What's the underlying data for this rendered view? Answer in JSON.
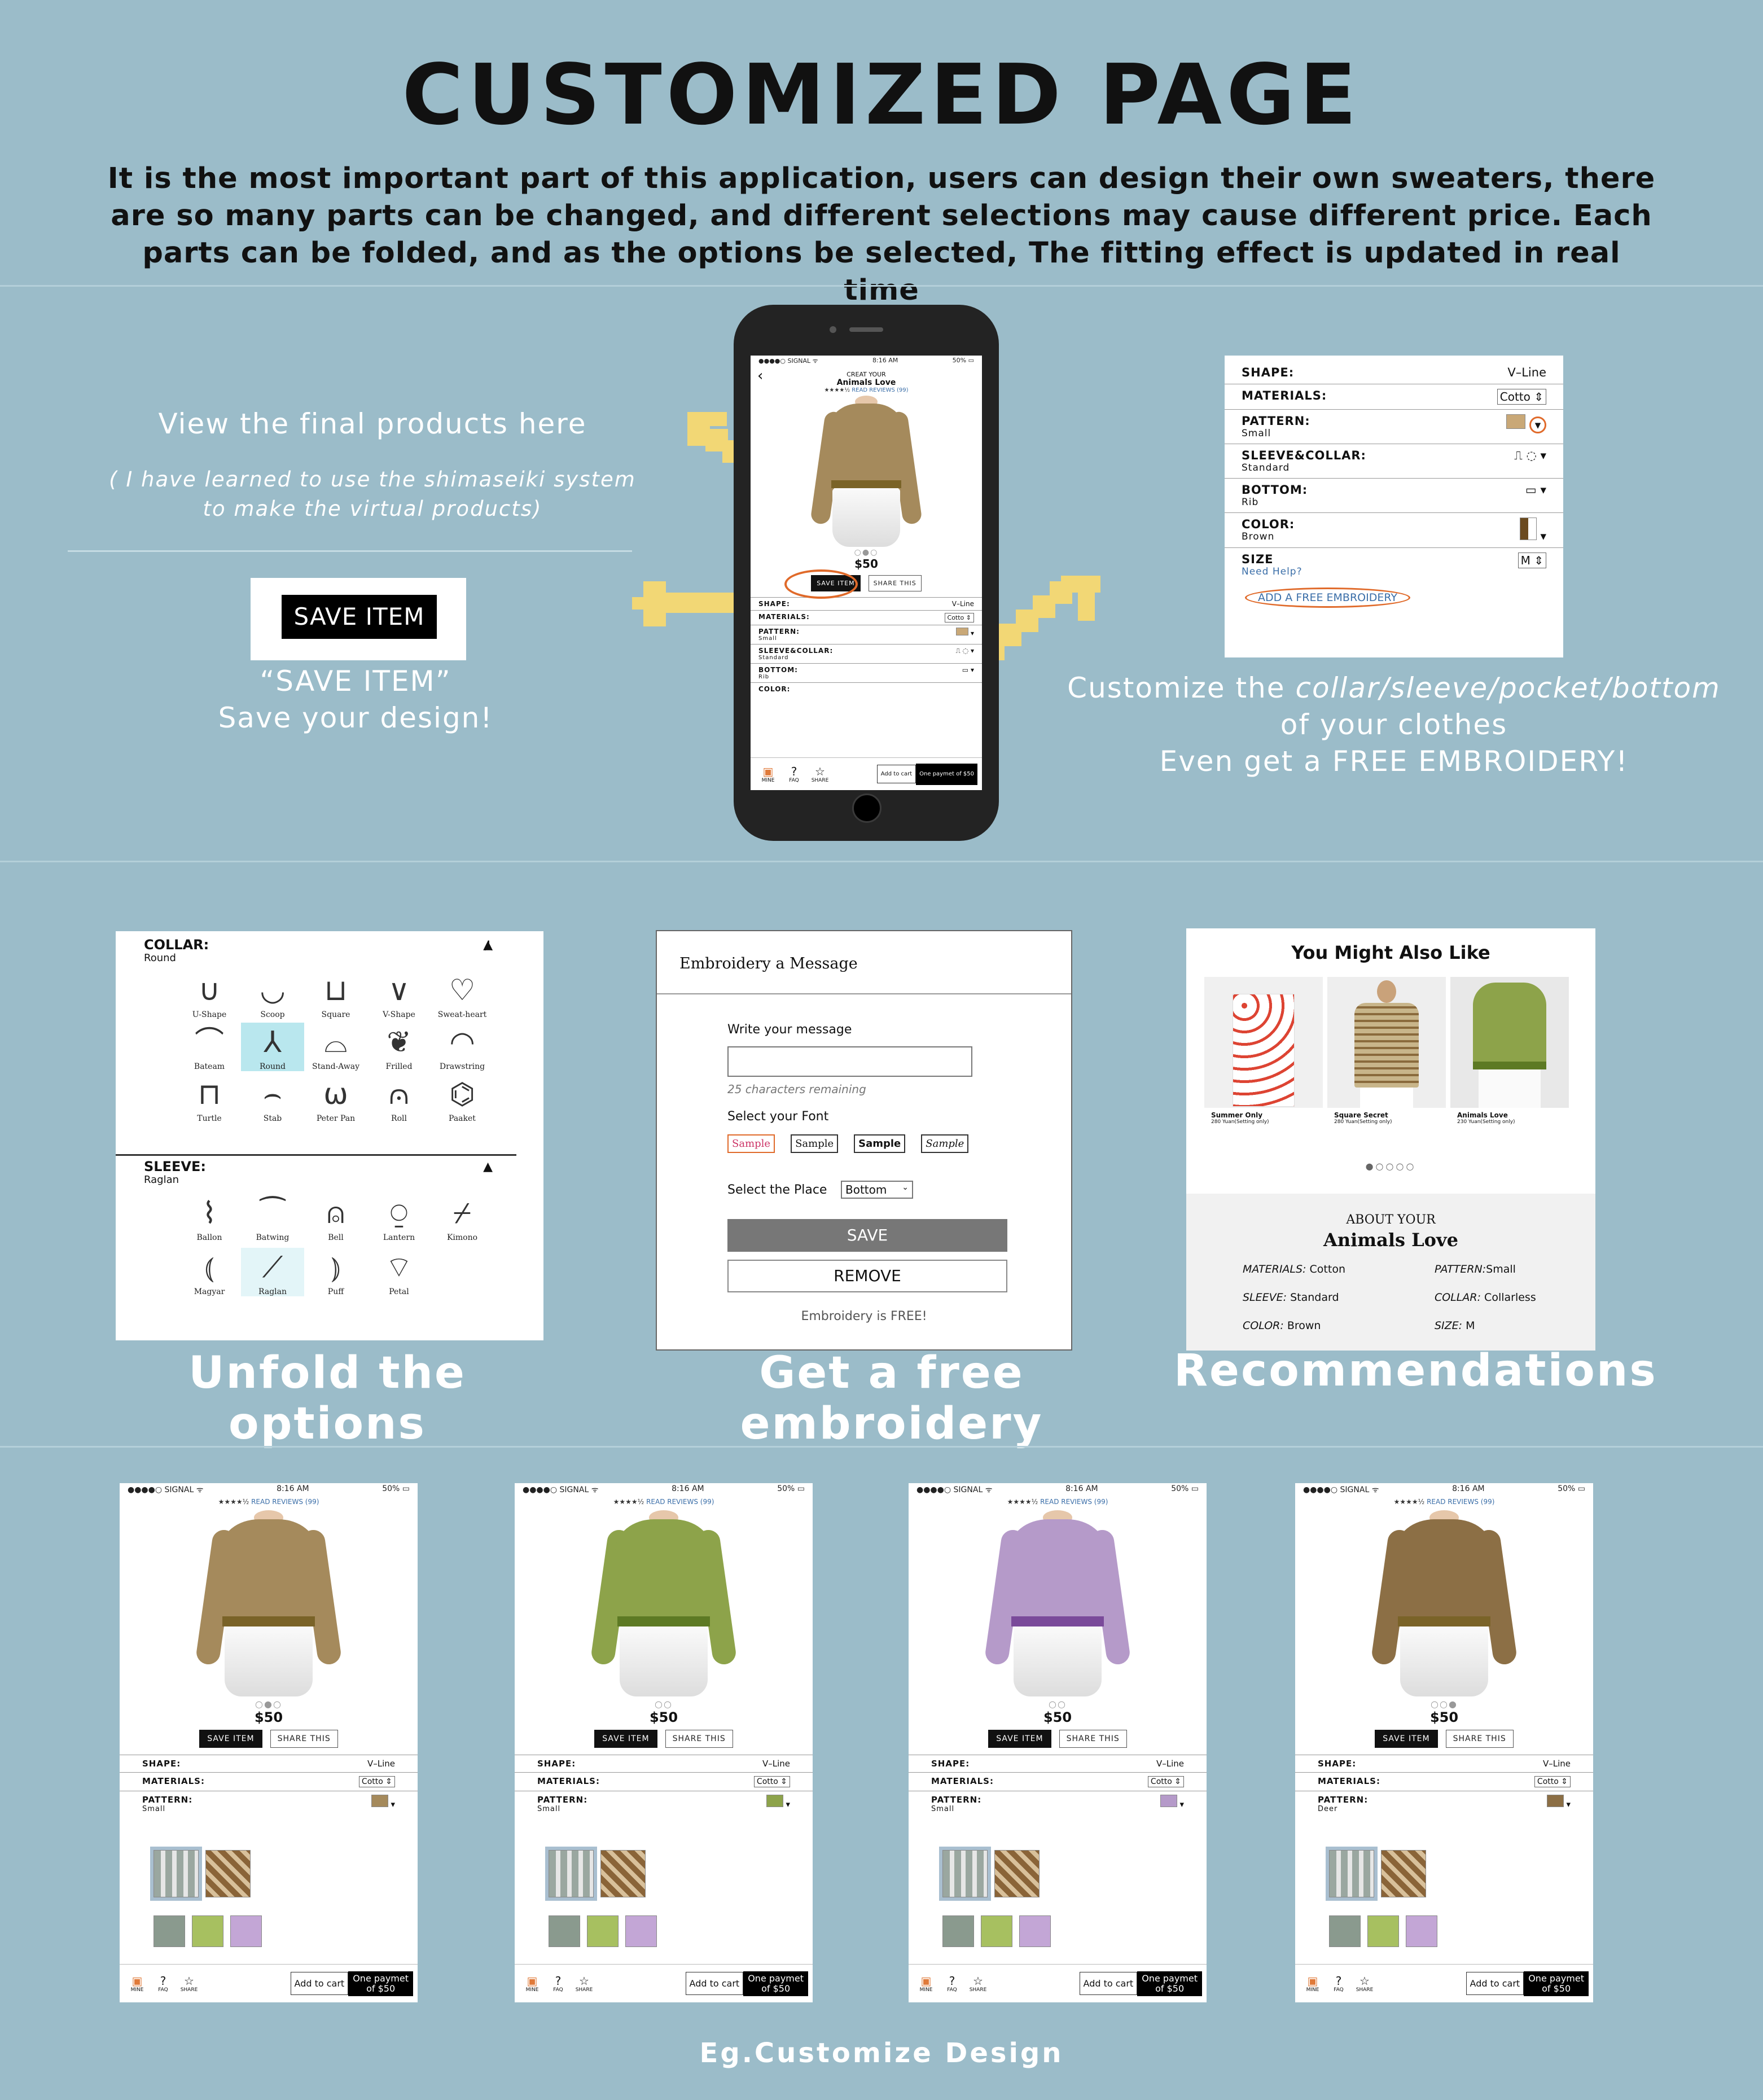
{
  "header": {
    "title": "CUSTOMIZED PAGE",
    "description": "It is the most important part of this application, users can design their  own sweaters, there are so many parts can be changed, and different selections may cause different price. Each parts can be folded, and as the options be selected, The fitting effect is updated in real time"
  },
  "left_notes": {
    "view_final": "View the final products here",
    "learned_1": "( I have learned to use the shimaseiki system",
    "learned_2": "to make the virtual products)",
    "save_button": "SAVE  ITEM",
    "save_quote": "“SAVE ITEM”",
    "save_caption": "Save your design!"
  },
  "right_notes": {
    "line1_prefix": "Customize the ",
    "line1_italic": "collar/sleeve/pocket/bottom",
    "line2": "of your clothes",
    "line3_prefix": "Even get a ",
    "line3_strong": "FREE EMBROIDERY!"
  },
  "phone": {
    "status": {
      "carrier": "●●●●○ SIGNAL ᯤ",
      "time": "8:16 AM",
      "battery": "50% ▭"
    },
    "back": "‹",
    "title_top": "CREAT YOUR",
    "title": "Animals Love",
    "stars": "★★★★½",
    "reviews": "READ REVIEWS (99)",
    "dots": "○●○",
    "price": "$50",
    "save": "SAVE  ITEM",
    "share": "SHARE  THIS",
    "options": [
      {
        "label": "SHAPE:",
        "sub": "",
        "value": "V–Line"
      },
      {
        "label": "MATERIALS:",
        "sub": "",
        "value": "Cotto ⇕"
      },
      {
        "label": "PATTERN:",
        "sub": "Small",
        "value": "▾"
      },
      {
        "label": "SLEEVE&COLLAR:",
        "sub": "Standard",
        "value": "▾"
      },
      {
        "label": "BOTTOM:",
        "sub": "Rib",
        "value": "▾"
      },
      {
        "label": "COLOR:",
        "sub": "",
        "value": ""
      }
    ],
    "tabs": [
      {
        "icon": "▣",
        "label": "MINE"
      },
      {
        "icon": "?",
        "label": "FAQ"
      },
      {
        "icon": "☆",
        "label": "SHARE"
      }
    ],
    "add_cart": "Add to cart",
    "one_pay": "One paymet  of $50"
  },
  "options_card": {
    "rows": [
      {
        "label": "SHAPE:",
        "sub": "",
        "value": "V–Line"
      },
      {
        "label": "MATERIALS:",
        "sub": "",
        "value": "Cotto ⇕"
      },
      {
        "label": "PATTERN:",
        "sub": "Small",
        "value": "▾"
      },
      {
        "label": "SLEEVE&COLLAR:",
        "sub": "Standard",
        "value": "▾"
      },
      {
        "label": "BOTTOM:",
        "sub": "Rib",
        "value": "▾"
      },
      {
        "label": "COLOR:",
        "sub": "Brown",
        "value": "▾"
      },
      {
        "label": "SIZE",
        "sub": "Need Help?",
        "value": "M ⇕"
      }
    ],
    "embroidery_link": "ADD A FREE EMBROIDERY"
  },
  "collar_card": {
    "collar_label": "COLLAR:",
    "collar_sub": "Round",
    "collars": [
      "U-Shape",
      "Scoop",
      "Square",
      "V-Shape",
      "Sweat-heart",
      "Bateam",
      "Round",
      "Stand-Away",
      "Frilled",
      "Drawstring",
      "Turtle",
      "Stab",
      "Peter Pan",
      "Roll",
      "Paaket"
    ],
    "sleeve_label": "SLEEVE:",
    "sleeve_sub": "Raglan",
    "sleeves": [
      "Ballon",
      "Batwing",
      "Bell",
      "Lantern",
      "Kimono",
      "Magyar",
      "Raglan",
      "Puff",
      "Petal"
    ]
  },
  "embroidery_card": {
    "title": "Embroidery a Message",
    "write_label": "Write your message",
    "remaining": "25 characters remaining",
    "font_label": "Select your Font",
    "fonts": [
      "Sample",
      "Sample",
      "Sample",
      "Sample"
    ],
    "place_label": "Select the Place",
    "place_value": "Bottom",
    "save": "SAVE",
    "remove": "REMOVE",
    "free": "Embroidery is FREE!"
  },
  "rec_card": {
    "title": "You Might Also Like",
    "items": [
      {
        "name": "Summer Only",
        "price": "280 Yuan(Setting only)"
      },
      {
        "name": "Square Secret",
        "price": "280 Yuan(Setting only)"
      },
      {
        "name": "Animals Love",
        "price": "230 Yuan(Setting only)"
      }
    ],
    "dots": "●○○○○",
    "about_label": "ABOUT YOUR",
    "about_title": "Animals Love",
    "specs": [
      {
        "k": "MATERIALS:",
        "v": "Cotton"
      },
      {
        "k": "PATTERN:",
        "v": "Small"
      },
      {
        "k": "SLEEVE:",
        "v": "Standard"
      },
      {
        "k": "COLLAR:",
        "v": "Collarless"
      },
      {
        "k": "COLOR:",
        "v": "Brown"
      },
      {
        "k": "SIZE:",
        "v": "M"
      }
    ]
  },
  "captions": {
    "unfold": "Unfold the options",
    "embroidery": "Get a free embroidery",
    "recommend": "Recommendations",
    "footer": "Eg.Customize Design"
  },
  "variants": [
    {
      "sweater": "#a58a5c",
      "band": "#7a6328",
      "pattern": "Small",
      "dots": "○●○"
    },
    {
      "sweater": "#8da34a",
      "band": "#5d7a24",
      "pattern": "Small",
      "dots": "○○"
    },
    {
      "sweater": "#b59ac9",
      "band": "#7a4a9a",
      "pattern": "Small",
      "dots": "○○"
    },
    {
      "sweater": "#8c6f45",
      "band": "#7a6328",
      "pattern": "Deer",
      "dots": "○○●"
    }
  ],
  "variant_common": {
    "status": {
      "carrier": "●●●●○ SIGNAL ᯤ",
      "time": "8:16 AM",
      "battery": "50% ▭"
    },
    "stars": "★★★★½",
    "reviews": "READ REVIEWS (99)",
    "price": "$50",
    "save": "SAVE  ITEM",
    "share": "SHARE  THIS",
    "shape_label": "SHAPE:",
    "shape_value": "V–Line",
    "materials_label": "MATERIALS:",
    "materials_value": "Cotto ⇕",
    "pattern_label": "PATTERN:",
    "tabs": [
      {
        "icon": "▣",
        "label": "MINE"
      },
      {
        "icon": "?",
        "label": "FAQ"
      },
      {
        "icon": "☆",
        "label": "SHARE"
      }
    ],
    "add_cart": "Add to cart",
    "one_pay_1": "One paymet",
    "one_pay_2": "of $50"
  },
  "colors": {
    "background": "#9bbcc9",
    "accent_hand": "#f2d775",
    "ring": "#e06a2a",
    "link": "#3a6ea8"
  }
}
